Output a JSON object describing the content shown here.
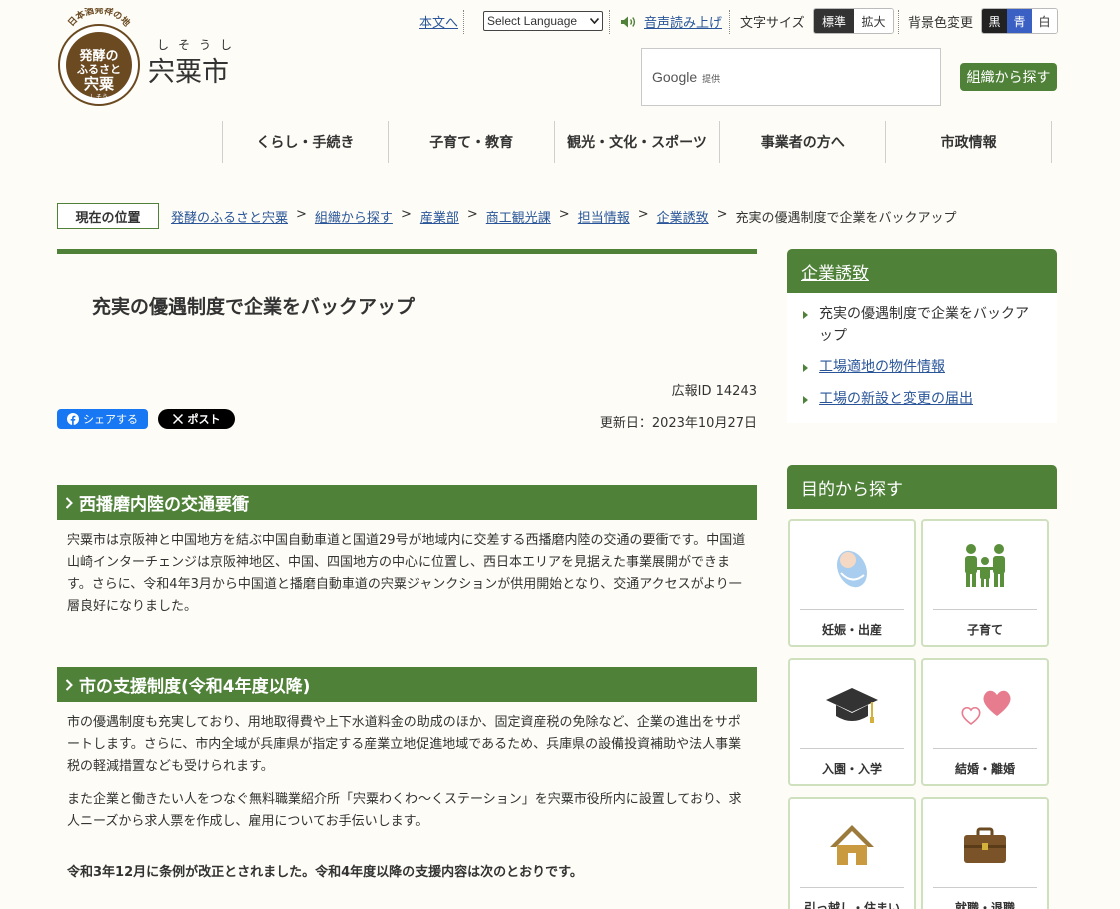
{
  "header": {
    "seal_top": "日本酒発祥の地",
    "seal_main": [
      "発酵の",
      "ふるさと",
      "宍粟"
    ],
    "seal_ruby": "しそう",
    "city_ruby": "しそうし",
    "city_name": "宍粟市",
    "skip_link": "本文へ",
    "language_select": "Select Language",
    "voice_reader": "音声読み上げ",
    "font_size_label": "文字サイズ",
    "font_size_options": [
      "標準",
      "拡大"
    ],
    "bg_color_label": "背景色変更",
    "bg_color_options": [
      "黒",
      "青",
      "白"
    ],
    "search_brand": "Google",
    "search_provided": "提供",
    "org_search_button": "組織から探す"
  },
  "global_nav": [
    "くらし・手続き",
    "子育て・教育",
    "観光・文化・スポーツ",
    "事業者の方へ",
    "市政情報"
  ],
  "breadcrumb": {
    "label": "現在の位置",
    "items": [
      "発酵のふるさと宍粟",
      "組織から探す",
      "産業部",
      "商工観光課",
      "担当情報",
      "企業誘致"
    ],
    "current": "充実の優遇制度で企業をバックアップ",
    "separator": ">"
  },
  "article": {
    "title": "充実の優遇制度で企業をバックアップ",
    "pr_id": "広報ID 14243",
    "updated": "更新日：2023年10月27日",
    "share_facebook": "シェアする",
    "share_x": "ポスト",
    "sections": [
      {
        "heading": "西播磨内陸の交通要衝",
        "paragraphs": [
          "宍粟市は京阪神と中国地方を結ぶ中国自動車道と国道29号が地域内に交差する西播磨内陸の交通の要衝です。中国道山崎インターチェンジは京阪神地区、中国、四国地方の中心に位置し、西日本エリアを見据えた事業展開ができます。さらに、令和4年3月から中国道と播磨自動車道の宍粟ジャンクションが供用開始となり、交通アクセスがより一層良好になりました。"
        ]
      },
      {
        "heading": "市の支援制度(令和4年度以降)",
        "paragraphs": [
          "市の優遇制度も充実しており、用地取得費や上下水道料金の助成のほか、固定資産税の免除など、企業の進出をサポートします。さらに、市内全域が兵庫県が指定する産業立地促進地域であるため、兵庫県の設備投資補助や法人事業税の軽減措置なども受けられます。",
          "また企業と働きたい人をつなぐ無料職業紹介所「宍粟わくわ～くステーション」を宍粟市役所内に設置しており、求人ニーズから求人票を作成し、雇用についてお手伝いします。",
          "令和3年12月に条例が改正とされました。令和4年度以降の支援内容は次のとおりです。"
        ]
      }
    ]
  },
  "sidebar": {
    "category_title": "企業誘致",
    "links": [
      "充実の優遇制度で企業をバックアップ",
      "工場適地の物件情報",
      "工場の新設と変更の届出"
    ],
    "purpose_title": "目的から探す",
    "purpose_tiles": [
      {
        "label": "妊娠・出産",
        "icon": "baby-icon"
      },
      {
        "label": "子育て",
        "icon": "family-icon"
      },
      {
        "label": "入園・入学",
        "icon": "graduation-cap-icon"
      },
      {
        "label": "結婚・離婚",
        "icon": "hearts-icon"
      },
      {
        "label": "引っ越し・住まい",
        "icon": "house-icon"
      },
      {
        "label": "就職・退職",
        "icon": "briefcase-icon"
      }
    ]
  },
  "colors": {
    "accent_green": "#4f8139",
    "link_blue": "#2a5699",
    "seal_brown": "#6b4a22",
    "facebook_blue": "#1877f2"
  }
}
